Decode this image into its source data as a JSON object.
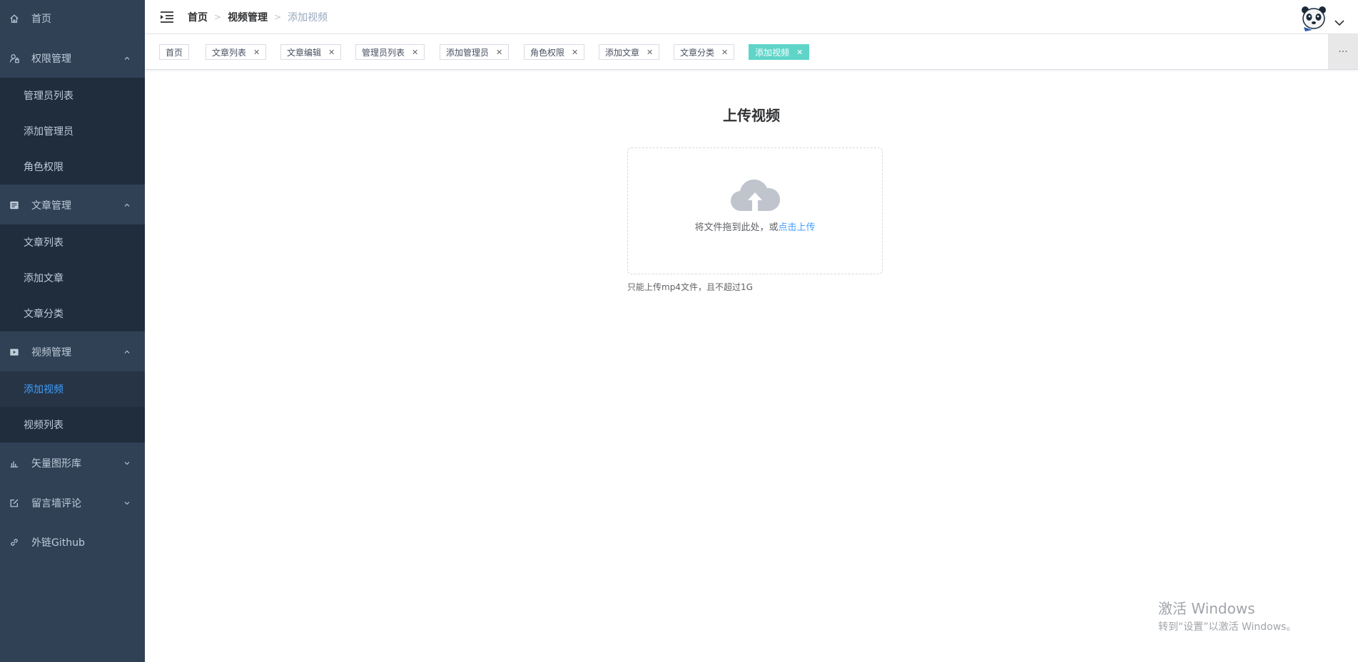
{
  "sidebar": {
    "home": {
      "label": "首页",
      "icon": "home-icon"
    },
    "perm": {
      "label": "权限管理",
      "icon": "user-lock-icon",
      "items": [
        "管理员列表",
        "添加管理员",
        "角色权限"
      ]
    },
    "article": {
      "label": "文章管理",
      "icon": "document-icon",
      "items": [
        "文章列表",
        "添加文章",
        "文章分类"
      ]
    },
    "video": {
      "label": "视频管理",
      "icon": "video-icon",
      "items": [
        "添加视频",
        "视频列表"
      ],
      "active_item": "添加视频"
    },
    "vector": {
      "label": "矢量图形库",
      "icon": "bar-chart-icon"
    },
    "comments": {
      "label": "留言墙评论",
      "icon": "edit-icon"
    },
    "github": {
      "label": "外链Github",
      "icon": "link-icon"
    }
  },
  "header": {
    "breadcrumb": [
      "首页",
      "视频管理",
      "添加视频"
    ]
  },
  "tags": [
    "首页",
    "文章列表",
    "文章编辑",
    "管理员列表",
    "添加管理员",
    "角色权限",
    "添加文章",
    "文章分类",
    "添加视频"
  ],
  "tags_more": "···",
  "main": {
    "title": "上传视频",
    "drop_text": "将文件拖到此处，或",
    "click_text": "点击上传",
    "tip": "只能上传mp4文件，且不超过1G"
  },
  "watermark": {
    "line1": "激活 Windows",
    "line2": "转到“设置”以激活 Windows。"
  },
  "colors": {
    "sidebar_bg": "#304156",
    "submenu_bg": "#1f2d3d",
    "active_text": "#409eff",
    "active_tag": "#5fd4c8"
  }
}
